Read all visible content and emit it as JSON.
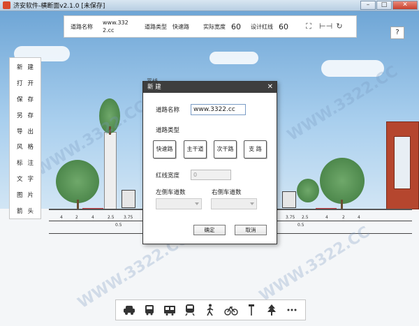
{
  "window": {
    "title": "济安软件-横断面v2.1.0  [未保存]",
    "minimize": "–",
    "maximize": "□",
    "close": "✕"
  },
  "topbar": {
    "road_name_label": "道路名称",
    "road_name_value": "www.3322.cc",
    "road_type_label": "道路类型",
    "road_type_value": "快速路",
    "actual_width_label": "实际宽度",
    "actual_width_value": "60",
    "design_red_line_label": "设计红线",
    "design_red_line_value": "60",
    "icons": [
      "fullscreen-icon",
      "fit-width-icon",
      "refresh-icon"
    ]
  },
  "help": {
    "label": "?"
  },
  "left_menu": [
    {
      "a": "新",
      "b": "建"
    },
    {
      "a": "打",
      "b": "开"
    },
    {
      "a": "保",
      "b": "存"
    },
    {
      "a": "另",
      "b": "存"
    },
    {
      "a": "导",
      "b": "出"
    },
    {
      "a": "风",
      "b": "格"
    },
    {
      "a": "标",
      "b": "注"
    },
    {
      "a": "文",
      "b": "字"
    },
    {
      "a": "图",
      "b": "片"
    },
    {
      "a": "箭",
      "b": "头"
    }
  ],
  "canvas": {
    "section_label": "平线",
    "dims_left": [
      "4",
      "2",
      "4",
      "2.5",
      "3.75"
    ],
    "dims_right": [
      "3.75",
      "2.5",
      "4",
      "2",
      "4"
    ],
    "sub_dims": [
      "0.5",
      "0.5"
    ],
    "watermark": "WWW.3322.CC"
  },
  "dialog": {
    "title": "新 建",
    "close": "✕",
    "road_name_label": "道路名称",
    "road_name_value": "www.3322.cc",
    "road_type_label": "道路类型",
    "types": [
      "快速路",
      "主干道",
      "次干路",
      "支 路"
    ],
    "red_line_width_label": "红线宽度",
    "red_line_width_value": "0",
    "left_lanes_label": "左侧车道数",
    "right_lanes_label": "右侧车道数",
    "ok": "确定",
    "cancel": "取消"
  },
  "bottom_toolbar": [
    "car-icon",
    "bus-icon",
    "tram-icon",
    "train-icon",
    "pedestrian-icon",
    "bicycle-icon",
    "street-lamp-icon",
    "tree-icon",
    "more-icon"
  ],
  "colors": {
    "dialog_header": "#3e3e3e",
    "curb_red": "#c7333a",
    "sky": "#a9cfee"
  }
}
